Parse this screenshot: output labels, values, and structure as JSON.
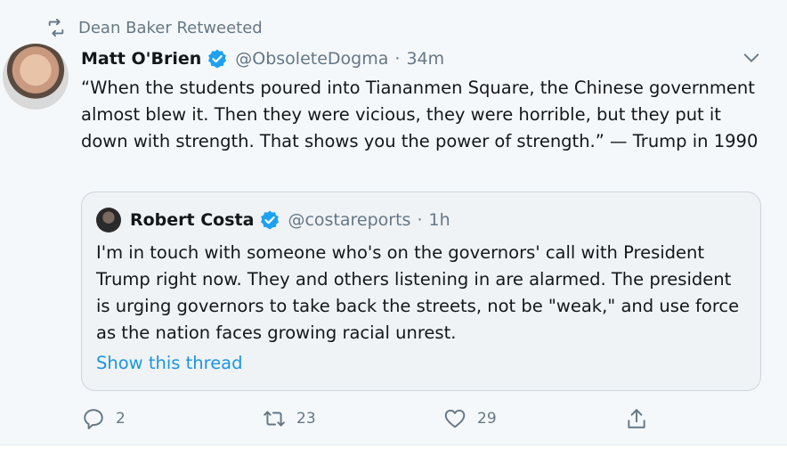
{
  "retweet": {
    "text": "Dean Baker Retweeted",
    "icon": "retweet-icon"
  },
  "tweet": {
    "author_name": "Matt O'Brien",
    "handle": "@ObsoleteDogma",
    "separator": "·",
    "time": "34m",
    "text": "“When the students poured into Tiananmen Square, the Chinese government almost blew it. Then they were vicious, they were horrible, but they put it down with strength. That shows you the power of strength.” — Trump in 1990"
  },
  "quoted": {
    "author_name": "Robert Costa",
    "handle": "@costareports",
    "separator": "·",
    "time": "1h",
    "text": "I'm in touch with someone who's on the governors' call with President Trump right now. They and others listening in are alarmed. The president is urging governors to take back the streets, not be \"weak,\" and use force as the nation faces growing racial unrest.",
    "show_thread": "Show this thread"
  },
  "actions": {
    "reply_count": "2",
    "retweet_count": "23",
    "like_count": "29"
  },
  "colors": {
    "accent": "#1da1f2",
    "link": "#1b95e0",
    "muted": "#657786",
    "text": "#14171a",
    "background": "#f5f8fa"
  }
}
